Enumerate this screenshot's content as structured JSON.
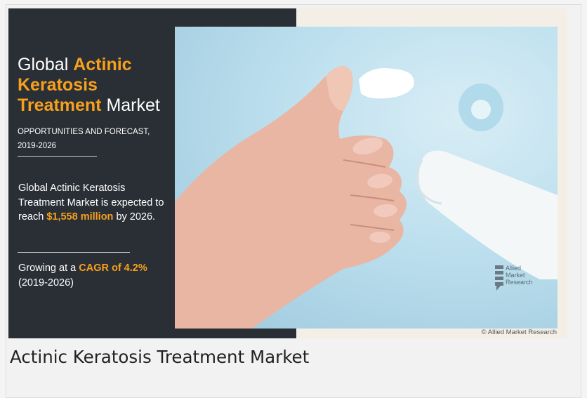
{
  "infographic": {
    "headline": {
      "w1": "Global",
      "w2": "Actinic",
      "w3": "Keratosis",
      "w4": "Treatment",
      "w5": "Market"
    },
    "subhead_line1": "OPPORTUNITIES AND FORECAST,",
    "subhead_line2": "2019-2026",
    "para1": {
      "text_before": "Global Actinic Keratosis Treatment Market is expected to reach",
      "highlight": "$1,558 million",
      "text_after": "by 2026."
    },
    "para2": {
      "text_before": "Growing at a",
      "highlight": "CAGR of 4.2%",
      "text_after": "(2019-2026)"
    },
    "watermark": {
      "line1": "Allied",
      "line2": "Market",
      "line3": "Research"
    },
    "credit": "© Allied Market Research",
    "colors": {
      "panel": "#2a2f35",
      "accent": "#f7a01d",
      "photo_bg": "#bcdfee"
    }
  },
  "caption": "Actinic Keratosis Treatment Market"
}
